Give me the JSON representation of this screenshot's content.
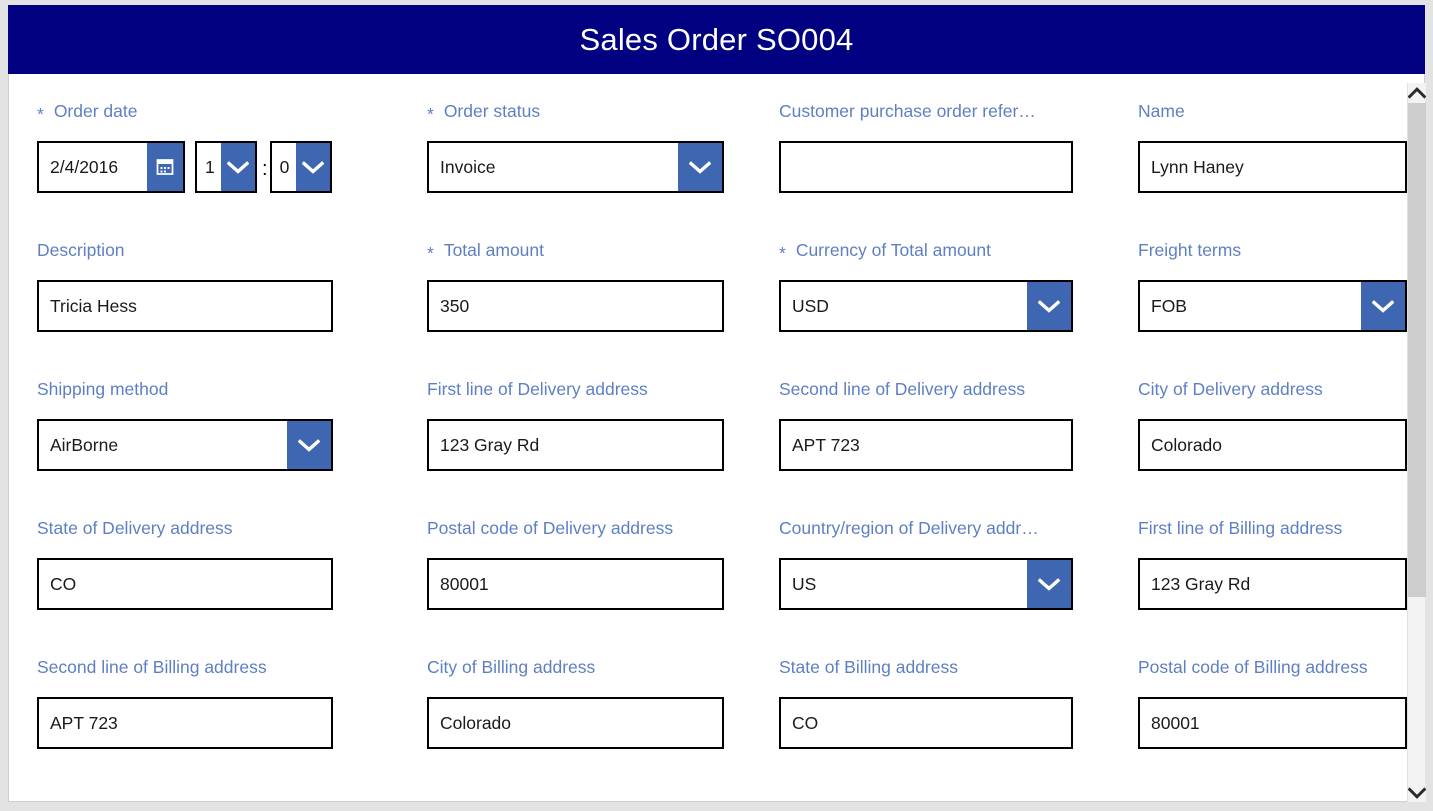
{
  "window": {
    "title": "Sales Order SO004",
    "header_bg": "#000080",
    "header_text_color": "#ffffff",
    "label_color": "#5f7fc4",
    "accent_blue": "#3f66b0",
    "panel_bg": "#ffffff"
  },
  "form": {
    "required_marker": "*",
    "rows": [
      {
        "fields": [
          {
            "label": "Order date",
            "required": true,
            "type": "datetime",
            "date_value": "2/4/2016",
            "hour_value": "1",
            "minute_value": "0",
            "time_separator": ":",
            "calendar_icon": "calendar-icon"
          },
          {
            "label": "Order status",
            "required": true,
            "type": "dropdown",
            "value": "Invoice"
          },
          {
            "label": "Customer purchase order refer…",
            "required": false,
            "type": "text",
            "value": ""
          },
          {
            "label": "Name",
            "required": false,
            "type": "text",
            "value": "Lynn Haney"
          }
        ]
      },
      {
        "fields": [
          {
            "label": "Description",
            "required": false,
            "type": "text",
            "value": "Tricia Hess"
          },
          {
            "label": "Total amount",
            "required": true,
            "type": "text",
            "value": "350"
          },
          {
            "label": "Currency of Total amount",
            "required": true,
            "type": "dropdown",
            "value": "USD"
          },
          {
            "label": "Freight terms",
            "required": false,
            "type": "dropdown",
            "value": "FOB"
          }
        ]
      },
      {
        "fields": [
          {
            "label": "Shipping method",
            "required": false,
            "type": "dropdown",
            "value": "AirBorne"
          },
          {
            "label": "First line of Delivery address",
            "required": false,
            "type": "text",
            "value": "123 Gray Rd"
          },
          {
            "label": "Second line of Delivery address",
            "required": false,
            "type": "text",
            "value": "APT 723"
          },
          {
            "label": "City of Delivery address",
            "required": false,
            "type": "text",
            "value": "Colorado"
          }
        ]
      },
      {
        "fields": [
          {
            "label": "State of Delivery address",
            "required": false,
            "type": "text",
            "value": "CO"
          },
          {
            "label": "Postal code of Delivery address",
            "required": false,
            "type": "text",
            "value": "80001"
          },
          {
            "label": "Country/region of Delivery addr…",
            "required": false,
            "type": "dropdown",
            "value": "US"
          },
          {
            "label": "First line of Billing address",
            "required": false,
            "type": "text",
            "value": "123 Gray Rd"
          }
        ]
      },
      {
        "fields": [
          {
            "label": "Second line of Billing address",
            "required": false,
            "type": "text",
            "value": "APT 723"
          },
          {
            "label": "City of Billing address",
            "required": false,
            "type": "text",
            "value": "Colorado"
          },
          {
            "label": "State of Billing address",
            "required": false,
            "type": "text",
            "value": "CO"
          },
          {
            "label": "Postal code of Billing address",
            "required": false,
            "type": "text",
            "value": "80001"
          }
        ]
      }
    ]
  },
  "scrollbar": {
    "up_icon": "chevron-up-icon",
    "down_icon": "chevron-down-icon"
  }
}
